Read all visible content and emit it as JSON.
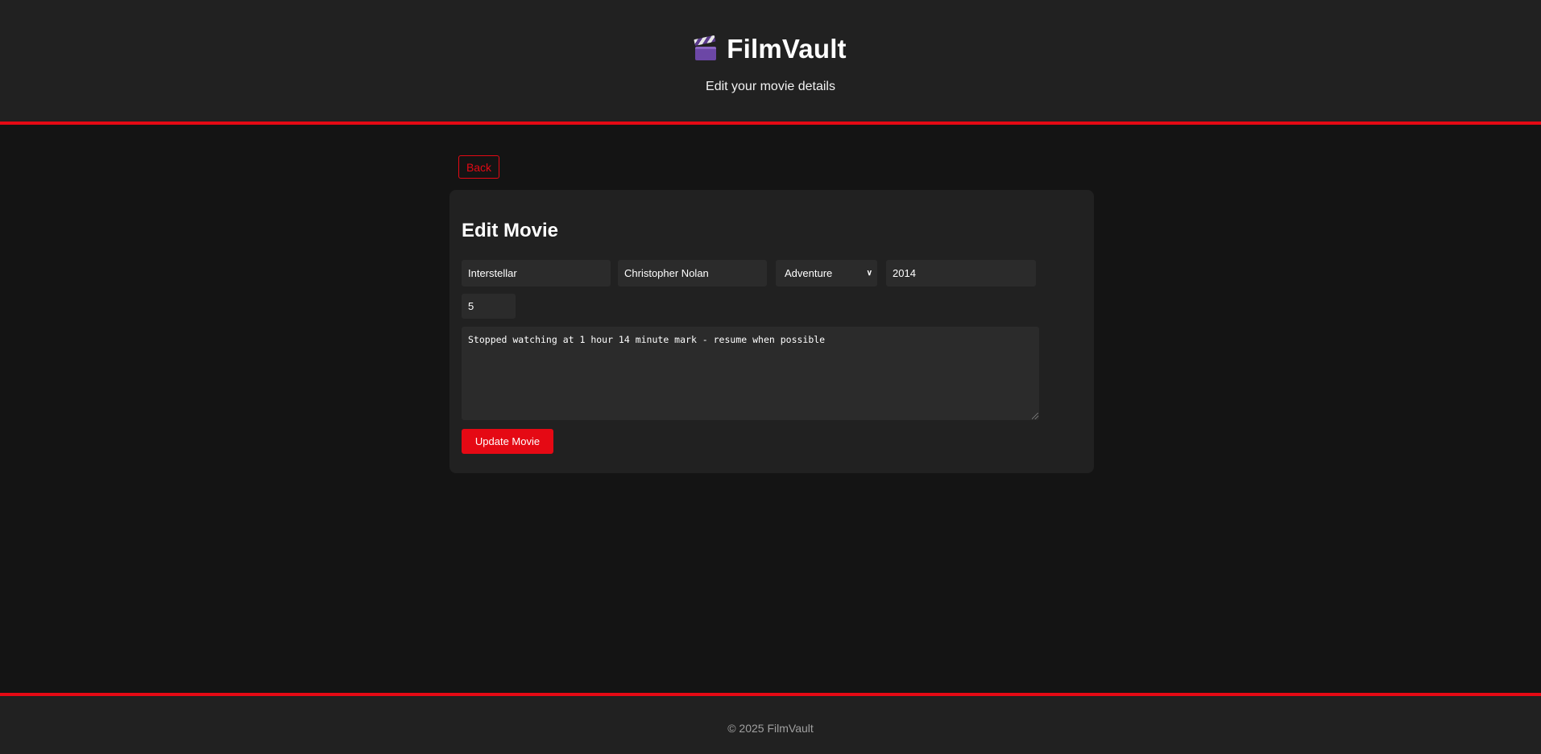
{
  "header": {
    "icon": "clapper-board-icon",
    "title": "FilmVault",
    "subtitle": "Edit your movie details"
  },
  "nav": {
    "back_label": "Back"
  },
  "form": {
    "heading": "Edit Movie",
    "title_value": "Interstellar",
    "director_value": "Christopher Nolan",
    "genre_selected": "Adventure",
    "year_value": "2014",
    "rating_value": "5",
    "notes_value": "Stopped watching at 1 hour 14 minute mark - resume when possible",
    "submit_label": "Update Movie"
  },
  "footer": {
    "copyright": "© 2025 FilmVault"
  },
  "colors": {
    "accent": "#e50914",
    "background": "#141414",
    "surface": "#212121",
    "input": "#2b2b2b"
  }
}
